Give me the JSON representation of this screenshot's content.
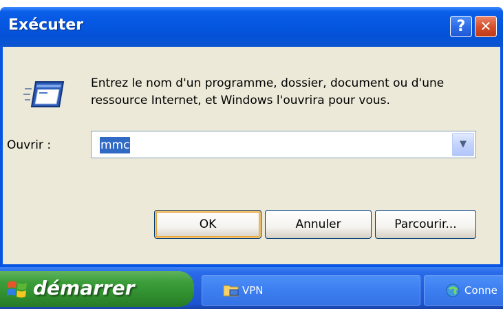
{
  "dialog": {
    "title": "Exécuter",
    "help_button": "?",
    "close_button": "✕",
    "description_line1": "Entrez le nom d'un programme, dossier, document ou d'une",
    "description_line2": "ressource Internet, et Windows l'ouvrira pour vous.",
    "open_label": "Ouvrir :",
    "open_value": "mmc",
    "ok_label": "OK",
    "cancel_label": "Annuler",
    "browse_label": "Parcourir..."
  },
  "taskbar": {
    "start_label": "démarrer",
    "items": [
      {
        "label": "VPN",
        "icon": "folder-network-icon"
      },
      {
        "label": "Conne",
        "icon": "network-connection-icon"
      }
    ]
  },
  "colors": {
    "title_blue": "#0556e0",
    "dialog_face": "#ece9d8",
    "start_green": "#3c9e3a",
    "taskbar_blue": "#245edb",
    "selection": "#316ac5"
  }
}
